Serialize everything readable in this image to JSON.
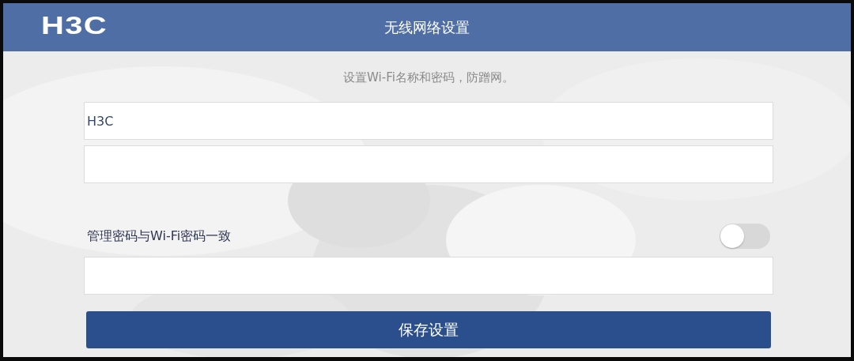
{
  "header": {
    "logo": "H3C",
    "title": "无线网络设置"
  },
  "subtitle": "设置Wi-Fi名称和密码，防蹭网。",
  "fields": [
    {
      "kind": "text",
      "value": "H3C"
    },
    {
      "kind": "password"
    }
  ],
  "admin_toggle": {
    "label": "管理密码与Wi-Fi密码一致",
    "on": false
  },
  "admin_field": {
    "kind": "password"
  },
  "save_button": "保存设置"
}
